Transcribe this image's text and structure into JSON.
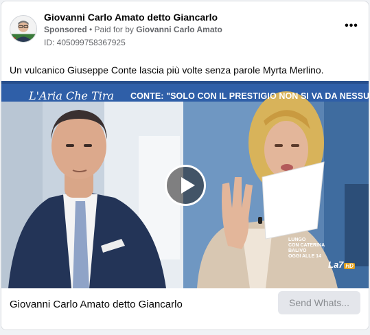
{
  "post": {
    "page_name": "Giovanni Carlo Amato detto Giancarlo",
    "sponsored": "Sponsored",
    "separator": " • ",
    "paid_for_prefix": "Paid for by ",
    "payer": "Giovanni Carlo Amato",
    "ad_id": "ID: 405099758367925",
    "more_icon": "more-options-icon",
    "caption": "Un vulcanico Giuseppe Conte lascia più volte senza parole Myrta Merlino."
  },
  "media": {
    "logo": "L'Aria Che Tira",
    "banner": "CONTE: \"SOLO CON IL PRESTIGIO NON SI VA DA NESSUNA PARTE\"",
    "lower_third_line1": "LUNGO",
    "lower_third_line2": "CON CATERINA BALIVO",
    "lower_third_line3": "OGGI ALLE 14",
    "channel": "La7",
    "channel_badge": "HD",
    "play_icon": "play-icon"
  },
  "footer": {
    "title": "Giovanni Carlo Amato detto Giancarlo",
    "cta_label": "Send Whats..."
  },
  "colors": {
    "banner_blue": "#2f5fa8",
    "cta_bg": "#e4e6eb",
    "meta_gray": "#65676b"
  }
}
